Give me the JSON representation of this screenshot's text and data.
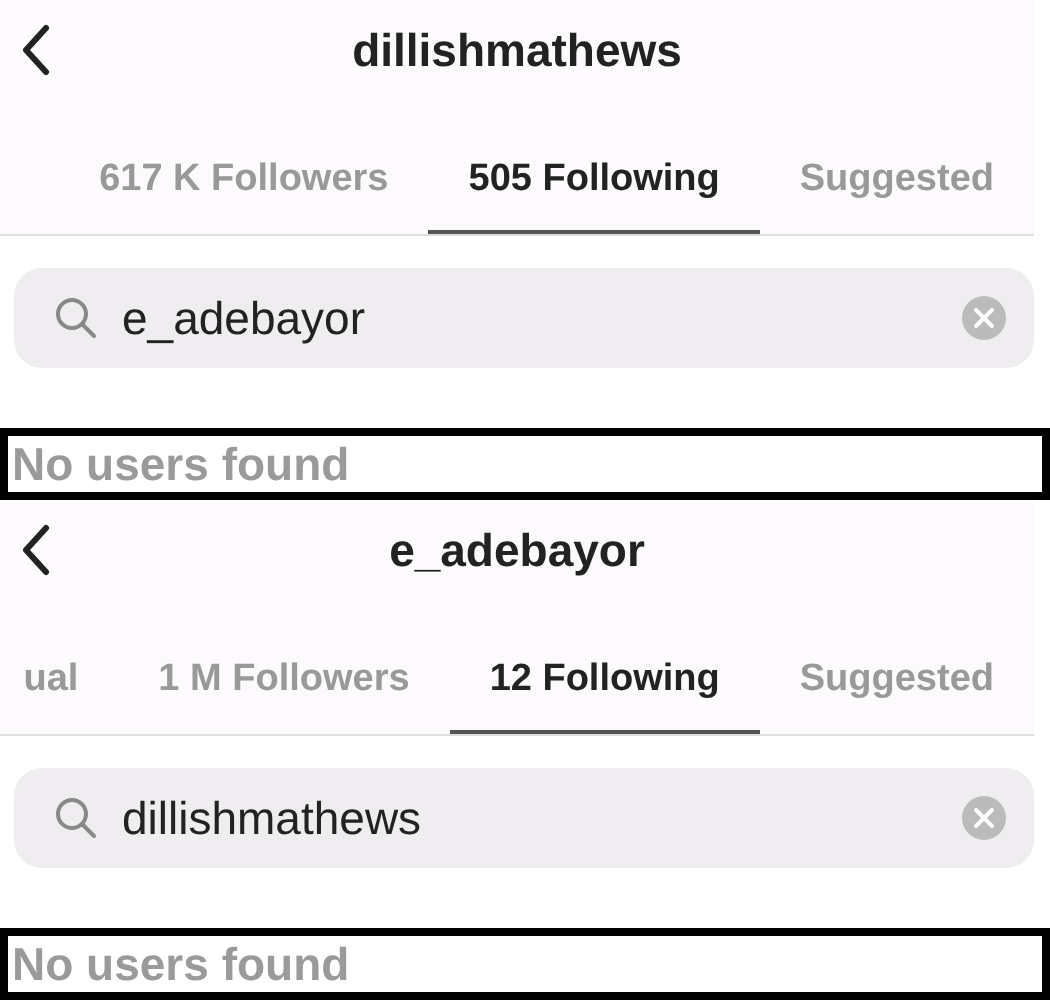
{
  "panels": [
    {
      "title": "dillishmathews",
      "tabs": [
        {
          "label": "617 K Followers",
          "selected": false
        },
        {
          "label": "505 Following",
          "selected": true
        },
        {
          "label": "Suggested",
          "selected": false
        }
      ],
      "search": {
        "value": "e_adebayor"
      },
      "result": "No users found"
    },
    {
      "title": "e_adebayor",
      "tabs": [
        {
          "label": "ual",
          "selected": false
        },
        {
          "label": "1 M Followers",
          "selected": false
        },
        {
          "label": "12 Following",
          "selected": true
        },
        {
          "label": "Suggested",
          "selected": false
        }
      ],
      "search": {
        "value": "dillishmathews"
      },
      "result": "No users found"
    }
  ]
}
